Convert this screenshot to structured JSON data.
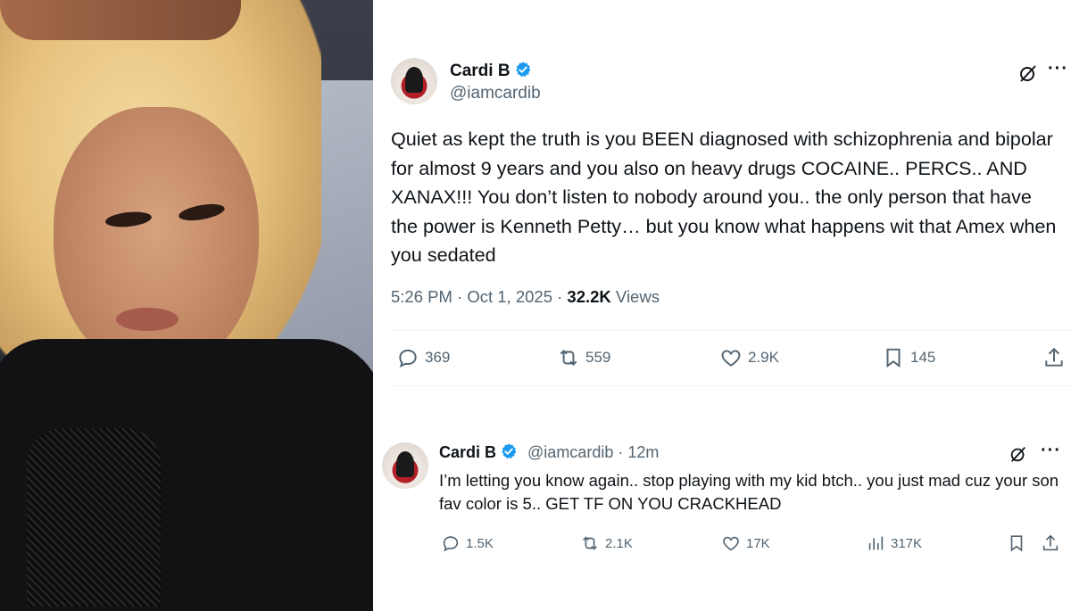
{
  "tweet1": {
    "name": "Cardi B",
    "handle": "@iamcardib",
    "text": "Quiet as kept the truth is you BEEN diagnosed with schizophrenia and bipolar for almost 9 years and you also on heavy drugs COCAINE.. PERCS.. AND XANAX!!! You don’t listen to nobody around you.. the only person that have the power is Kenneth Petty… but you know what happens wit that Amex when you sedated",
    "time": "5:26 PM · Oct 1, 2025 · ",
    "views_count": "32.2K",
    "views_label": " Views",
    "more": "···",
    "actions": {
      "replies": "369",
      "reposts": "559",
      "likes": "2.9K",
      "bookmarks": "145"
    }
  },
  "tweet2": {
    "name": "Cardi B",
    "handle": "@iamcardib",
    "sep": "·",
    "age": "12m",
    "text": "I’m letting you know again.. stop playing with my kid btch.. you just mad cuz your son fav color is 5.. GET TF ON YOU CRACKHEAD",
    "actions": {
      "replies": "1.5K",
      "reposts": "2.1K",
      "likes": "17K",
      "views": "317K"
    }
  },
  "colors": {
    "verified": "#1d9bf0",
    "text": "#0f1419",
    "secondary": "#536471",
    "divider": "#eff3f4"
  },
  "icons": [
    "verified-badge-icon",
    "grok-icon",
    "more-icon",
    "reply-icon",
    "repost-icon",
    "like-icon",
    "bookmark-icon",
    "share-icon",
    "views-icon"
  ]
}
